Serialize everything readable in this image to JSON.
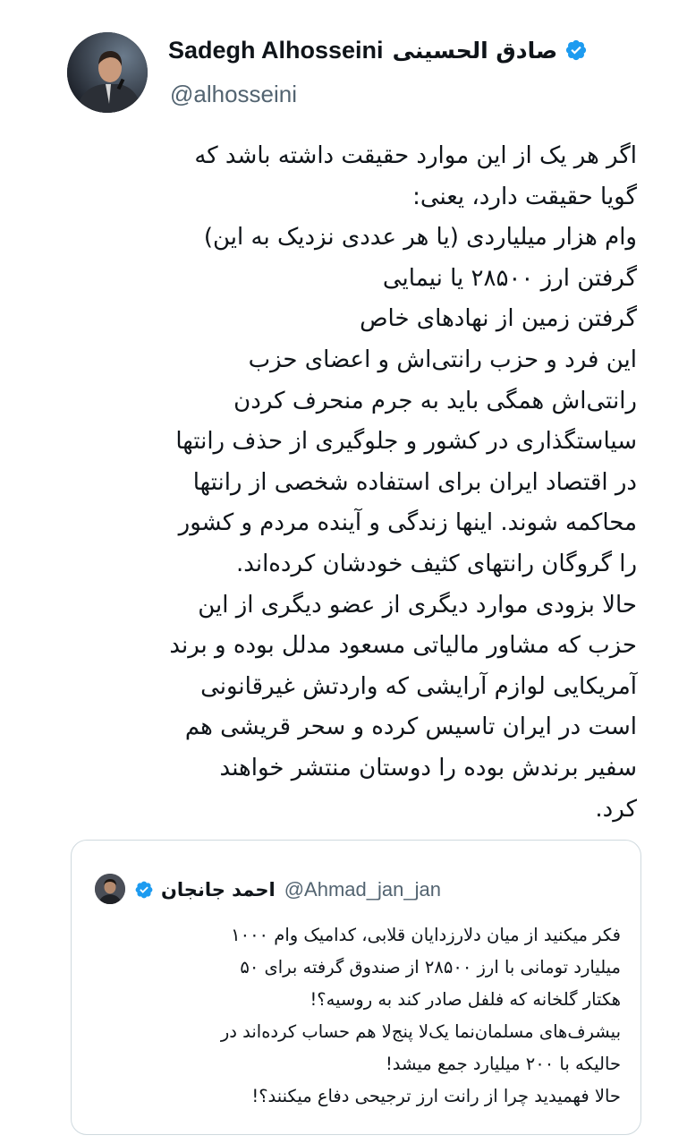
{
  "tweet": {
    "author_name_en": "Sadegh Alhosseini",
    "author_name_fa": "صادق الحسینی",
    "handle": "@alhosseini",
    "lines": [
      "اگر هر یک از این موارد حقیقت داشته باشد که",
      "گویا حقیقت دارد، یعنی:",
      "وام هزار میلیاردی (یا هر عددی نزدیک به این)",
      "گرفتن ارز ۲۸۵۰۰ یا نیمایی",
      "گرفتن زمین از نهادهای خاص",
      "این فرد و حزب رانتی‌اش و اعضای حزب",
      "رانتی‌اش همگی باید به جرم منحرف کردن",
      "سیاستگذاری در کشور و جلوگیری از حذف رانتها",
      "در اقتصاد ایران برای استفاده شخصی از رانتها",
      "محاکمه شوند. اینها زندگی و آینده مردم و کشور",
      "را گروگان رانتهای کثیف خودشان کرده‌اند.",
      "حالا بزودی موارد دیگری از عضو دیگری از این",
      "حزب که مشاور مالیاتی مسعود مدلل بوده و برند",
      "آمریکایی لوازم آرایشی که واردتش غیرقانونی",
      "است در ایران تاسیس کرده و سحر قریشی هم",
      "سفیر برندش بوده را دوستان منتشر خواهند",
      "کرد."
    ]
  },
  "quoted": {
    "name": "احمد جانجان",
    "handle": "@Ahmad_jan_jan",
    "lines": [
      "فکر میکنید از میان دلارزدایان قلابی، کدامیک وام ۱۰۰۰",
      "میلیارد تومانی با ارز ۲۸۵۰۰ از صندوق گرفته برای ۵۰",
      "هکتار گلخانه که فلفل صادر کند به روسیه؟!",
      "بیشرف‌های مسلمان‌نما یک‌لا پنج‌لا هم حساب کرده‌اند در",
      "حالیکه با ۲۰۰ میلیارد جمع میشد!",
      "حالا فهمیدید چرا از رانت ارز ترجیحی دفاع میکنند؟!"
    ]
  },
  "colors": {
    "verified": "#1d9bf0",
    "handle": "#536471",
    "border": "#cfd9de"
  },
  "icons": {
    "verified": "verified-badge-icon"
  }
}
